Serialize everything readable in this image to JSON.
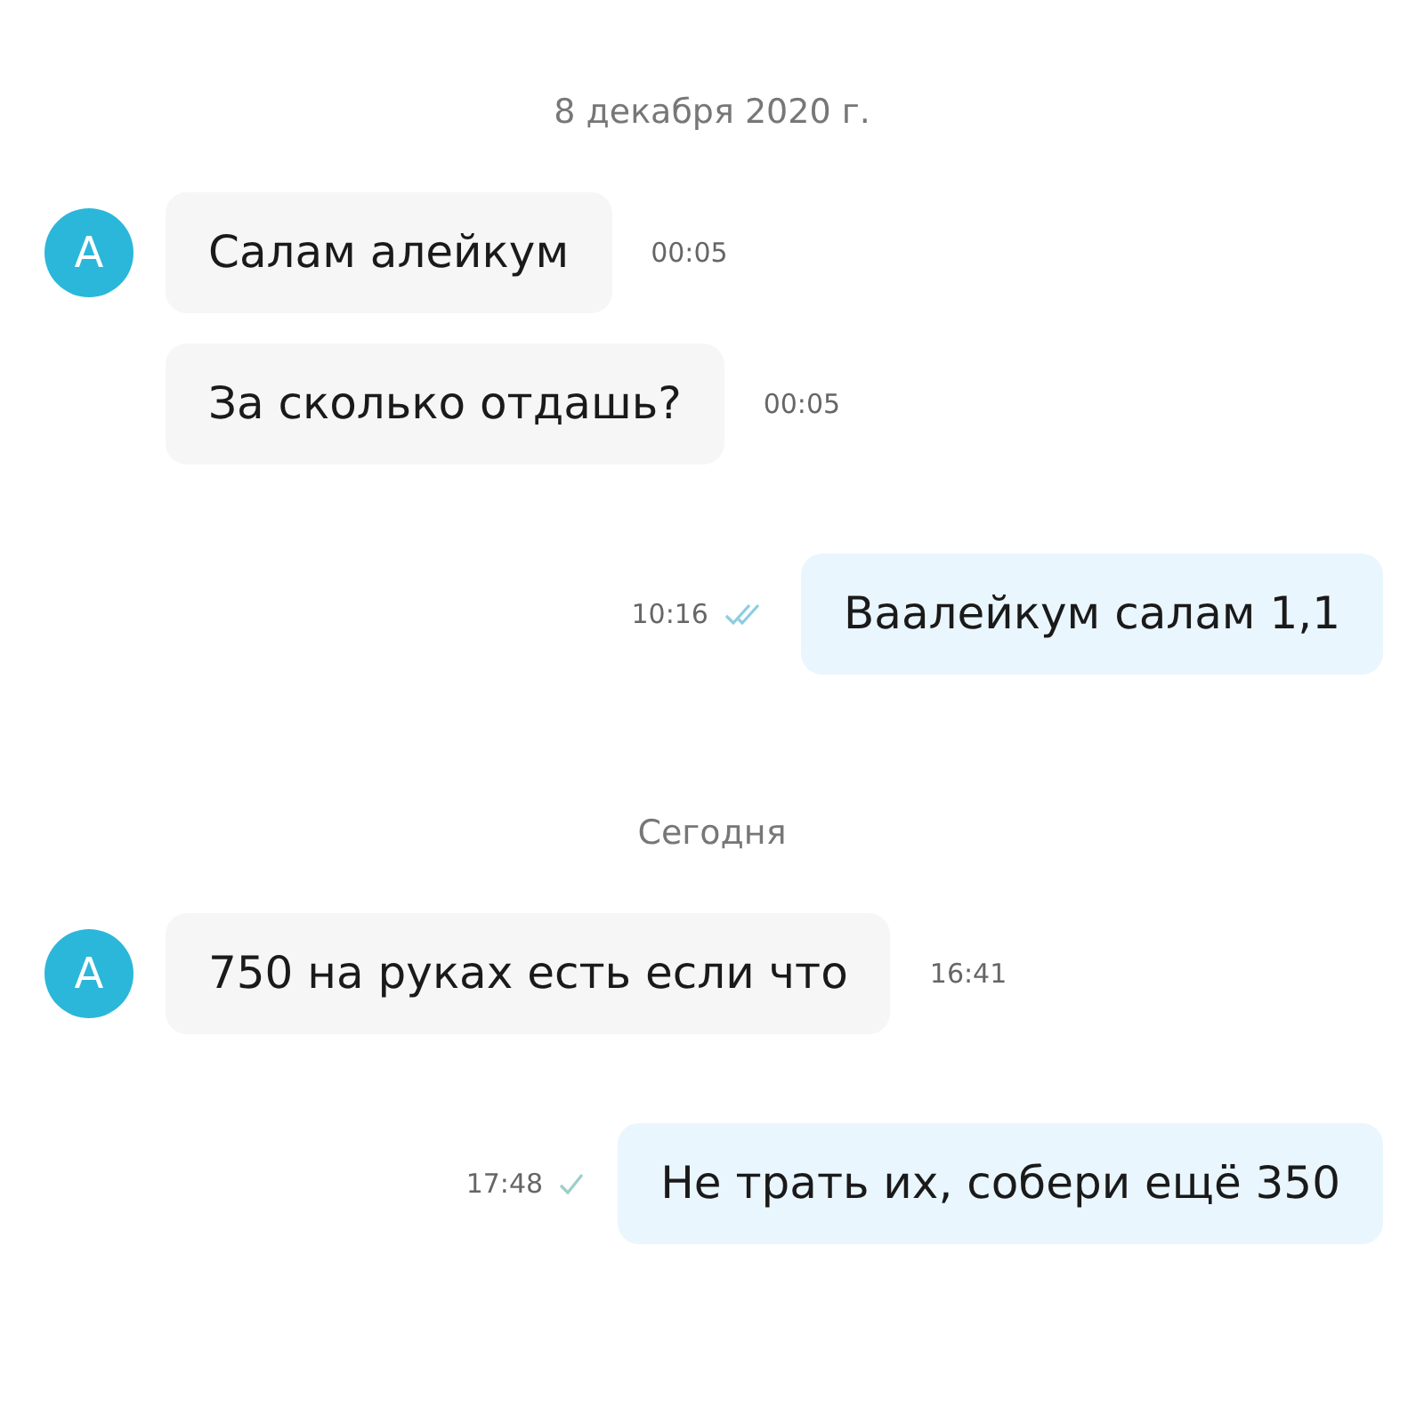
{
  "items": [
    {
      "kind": "date",
      "text": "8 декабря 2020 г."
    },
    {
      "kind": "incoming",
      "avatar": "A",
      "text": "Салам алейкум",
      "time": "00:05"
    },
    {
      "kind": "incoming",
      "text": "За сколько отдашь?",
      "time": "00:05"
    },
    {
      "kind": "outgoing",
      "text": "Ваалейкум салам 1,1",
      "time": "10:16",
      "read": true
    },
    {
      "kind": "date",
      "text": "Сегодня"
    },
    {
      "kind": "incoming",
      "avatar": "A",
      "text": "750 на руках есть если что",
      "time": "16:41"
    },
    {
      "kind": "outgoing",
      "text": "Не трать их, собери ещё 350",
      "time": "17:48",
      "read": false
    }
  ]
}
